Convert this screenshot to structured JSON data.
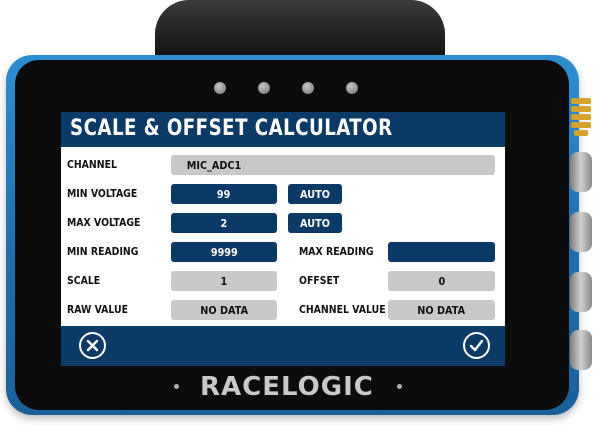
{
  "screen": {
    "title": "SCALE & OFFSET CALCULATOR",
    "channel": {
      "label": "CHANNEL",
      "value": "MIC_ADC1"
    },
    "min_voltage": {
      "label": "MIN VOLTAGE",
      "value": "99",
      "auto_label": "AUTO"
    },
    "max_voltage": {
      "label": "MAX VOLTAGE",
      "value": "2",
      "auto_label": "AUTO"
    },
    "min_reading": {
      "label": "MIN READING",
      "value": "9999"
    },
    "max_reading": {
      "label": "MAX READING",
      "value": ""
    },
    "scale": {
      "label": "SCALE",
      "value": "1"
    },
    "offset": {
      "label": "OFFSET",
      "value": "0"
    },
    "raw_value": {
      "label": "RAW VALUE",
      "value": "NO DATA"
    },
    "channel_value": {
      "label": "CHANNEL VALUE",
      "value": "NO DATA"
    },
    "buttons": {
      "cancel_icon": "close-icon",
      "confirm_icon": "checkmark-icon"
    }
  },
  "device": {
    "brand": "RACELOGIC"
  },
  "colors": {
    "panel_blue": "#0c3a66",
    "field_grey": "#c8c8c8",
    "housing_blue": "#2d8fd0"
  }
}
